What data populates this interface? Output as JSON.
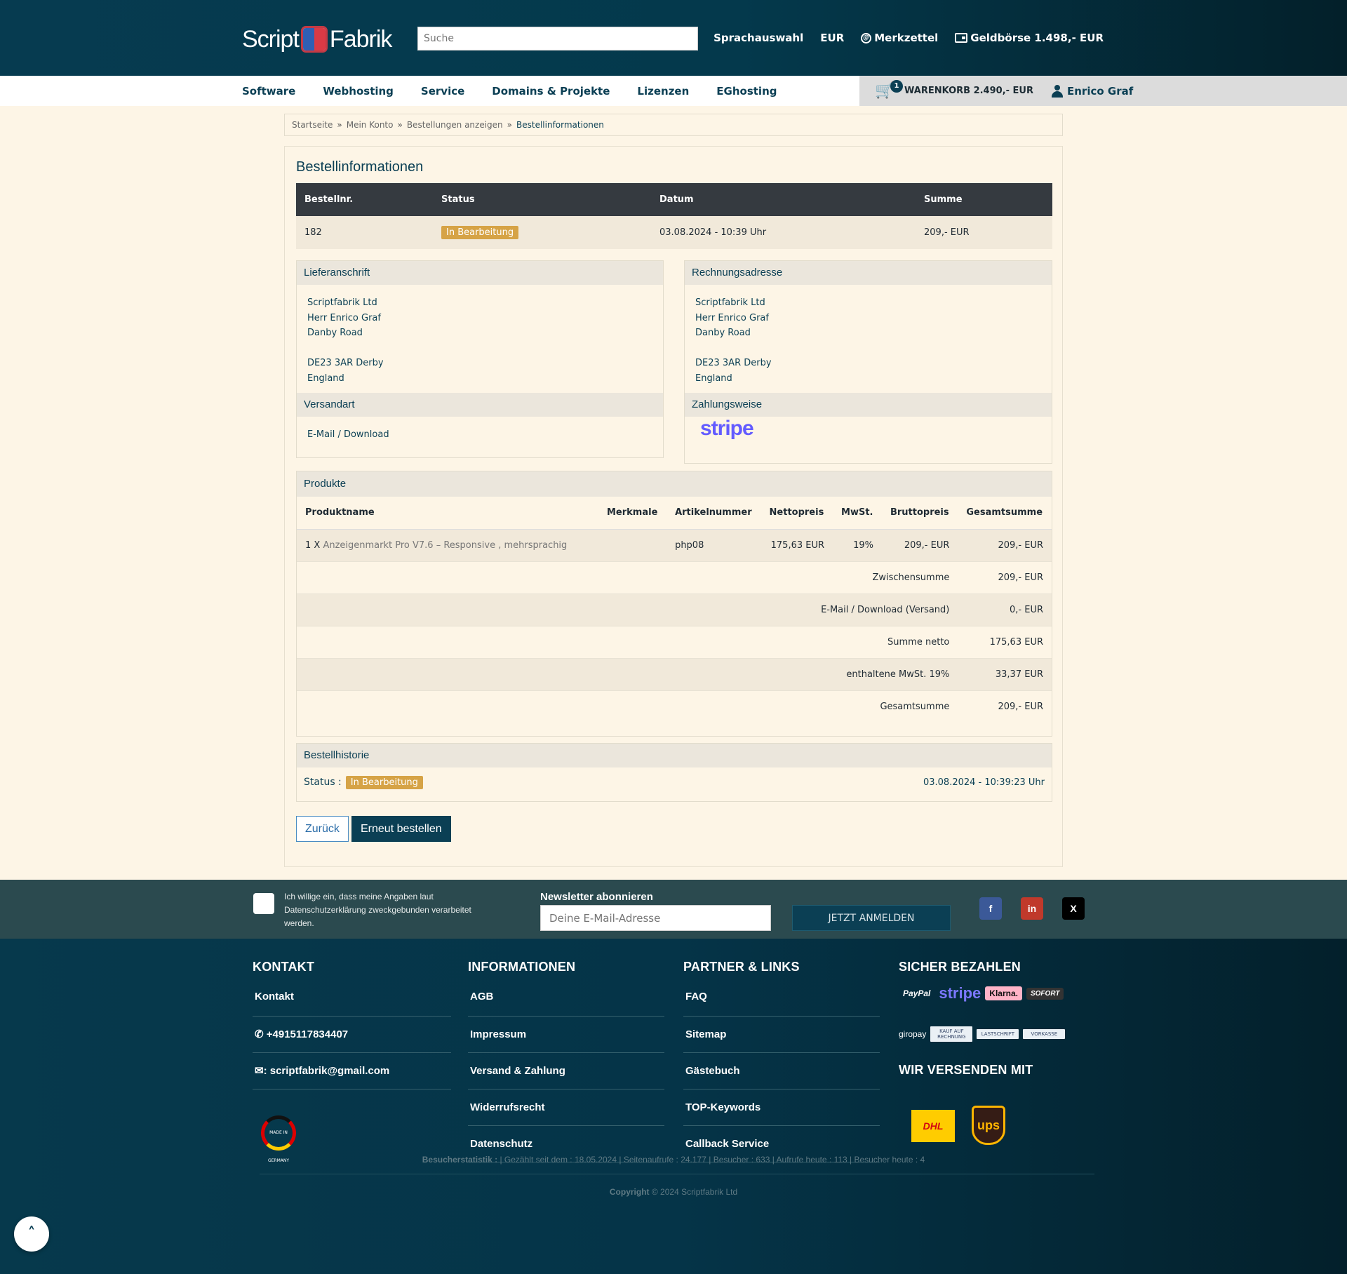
{
  "header": {
    "logo_part1": "Script",
    "logo_part2": "Fabrik",
    "search_placeholder": "Suche",
    "language": "Sprachauswahl",
    "currency": "EUR",
    "wishlist": "Merkzettel",
    "wallet": "Geldbörse 1.498,- EUR"
  },
  "nav": {
    "items": [
      "Software",
      "Webhosting",
      "Service",
      "Domains & Projekte",
      "Lizenzen",
      "EGhosting"
    ],
    "cart_count": "1",
    "cart_label": "WARENKORB 2.490,- EUR",
    "user": "Enrico Graf"
  },
  "breadcrumb": [
    "Startseite",
    "Mein Konto",
    "Bestellungen anzeigen",
    "Bestellinformationen"
  ],
  "order": {
    "title": "Bestellinformationen",
    "headers": [
      "Bestellnr.",
      "Status",
      "Datum",
      "Summe"
    ],
    "number": "182",
    "status": "In Bearbeitung",
    "date": "03.08.2024 - 10:39 Uhr",
    "sum": "209,- EUR"
  },
  "delivery": {
    "title": "Lieferanschrift",
    "lines": [
      "Scriptfabrik Ltd",
      "Herr Enrico Graf",
      "Danby Road",
      "",
      "DE23 3AR Derby",
      "England"
    ]
  },
  "billing": {
    "title": "Rechnungsadresse",
    "lines": [
      "Scriptfabrik Ltd",
      "Herr Enrico Graf",
      "Danby Road",
      "",
      "DE23 3AR Derby",
      "England"
    ]
  },
  "shipping": {
    "title": "Versandart",
    "value": "E-Mail / Download"
  },
  "payment": {
    "title": "Zahlungsweise",
    "logo": "stripe"
  },
  "products": {
    "title": "Produkte",
    "headers": [
      "Produktname",
      "Merkmale",
      "Artikelnummer",
      "Nettopreis",
      "MwSt.",
      "Bruttopreis",
      "Gesamtsumme"
    ],
    "item_qty": "1 X",
    "item_name": "Anzeigenmarkt Pro V7.6 – Responsive , mehrsprachig",
    "item_features": "",
    "item_sku": "php08",
    "item_net": "175,63 EUR",
    "item_tax": "19%",
    "item_gross": "209,- EUR",
    "item_total": "209,- EUR",
    "totals": [
      {
        "label": "Zwischensumme",
        "value": "209,- EUR"
      },
      {
        "label": "E-Mail / Download (Versand)",
        "value": "0,- EUR"
      },
      {
        "label": "Summe netto",
        "value": "175,63 EUR"
      },
      {
        "label": "enthaltene MwSt. 19%",
        "value": "33,37 EUR"
      },
      {
        "label": "Gesamtsumme",
        "value": "209,- EUR"
      }
    ]
  },
  "history": {
    "title": "Bestellhistorie",
    "status_label": "Status :",
    "status": "In Bearbeitung",
    "date": "03.08.2024 - 10:39:23 Uhr"
  },
  "buttons": {
    "back": "Zurück",
    "reorder": "Erneut bestellen"
  },
  "newsletter": {
    "consent": "Ich willige ein, dass meine Angaben laut Datenschutzerklärung zweckgebunden verarbeitet werden.",
    "title": "Newsletter abonnieren",
    "placeholder": "Deine E-Mail-Adresse",
    "button": "JETZT ANMELDEN"
  },
  "footer": {
    "contact_title": "KONTAKT",
    "contact_links": [
      "Kontakt",
      "+4915117834407",
      ": scriptfabrik@gmail.com"
    ],
    "info_title": "INFORMATIONEN",
    "info_links": [
      "AGB",
      "Impressum",
      "Versand & Zahlung",
      "Widerrufsrecht",
      "Datenschutz"
    ],
    "partner_title": "PARTNER & LINKS",
    "partner_links": [
      "FAQ",
      "Sitemap",
      "Gästebuch",
      "TOP-Keywords",
      "Callback Service"
    ],
    "pay_title": "SICHER BEZAHLEN",
    "pay_logos": [
      "PayPal",
      "stripe",
      "Klarna.",
      "SOFORT",
      "giropay",
      "KAUF AUF RECHNUNG",
      "LASTSCHRIFT",
      "VORKASSE"
    ],
    "ship_title": "WIR VERSENDEN MIT",
    "ship_logos": [
      "DHL",
      "ups"
    ],
    "made_in": "MADE IN GERMANY",
    "stats_label": "Besucherstatistik :",
    "stats": " | Gezählt seit dem : 18.05.2024 | Seitenaufrufe : 24.177 | Besucher : 633 | Aufrufe heute : 113 | Besucher heute : 4",
    "copyright_label": "Copyright",
    "copyright": " © 2024 Scriptfabrik Ltd"
  },
  "colors": {
    "primary": "#0b3f54",
    "badge": "#d6a346",
    "page_bg": "#fdf5e6"
  }
}
